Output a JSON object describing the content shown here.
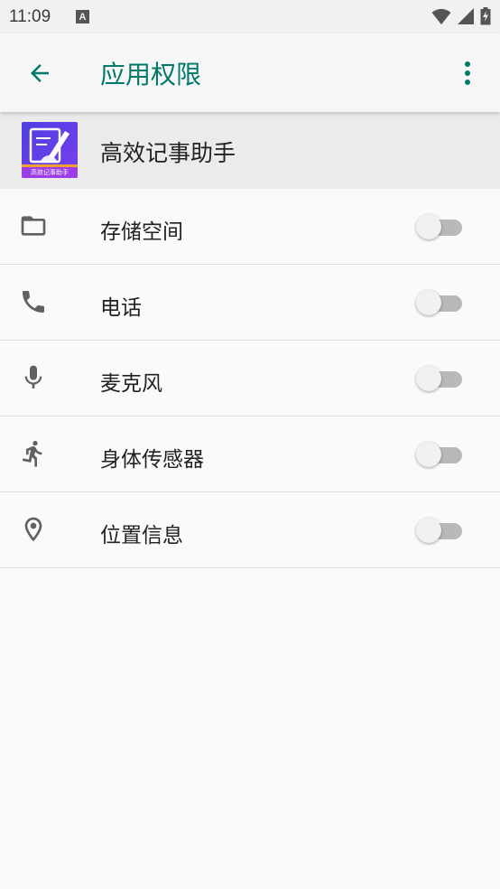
{
  "status_bar": {
    "time": "11:09",
    "notification_letter": "A"
  },
  "app_bar": {
    "title": "应用权限"
  },
  "app": {
    "name": "高效记事助手",
    "icon_caption": "高效记事助手"
  },
  "permissions": [
    {
      "label": "存储空间",
      "icon": "folder-icon",
      "enabled": false
    },
    {
      "label": "电话",
      "icon": "phone-icon",
      "enabled": false
    },
    {
      "label": "麦克风",
      "icon": "microphone-icon",
      "enabled": false
    },
    {
      "label": "身体传感器",
      "icon": "running-person-icon",
      "enabled": false
    },
    {
      "label": "位置信息",
      "icon": "location-pin-icon",
      "enabled": false
    }
  ],
  "colors": {
    "accent": "#00796b",
    "icon_gray": "#616161",
    "switch_off_track": "#b9b9b9"
  }
}
